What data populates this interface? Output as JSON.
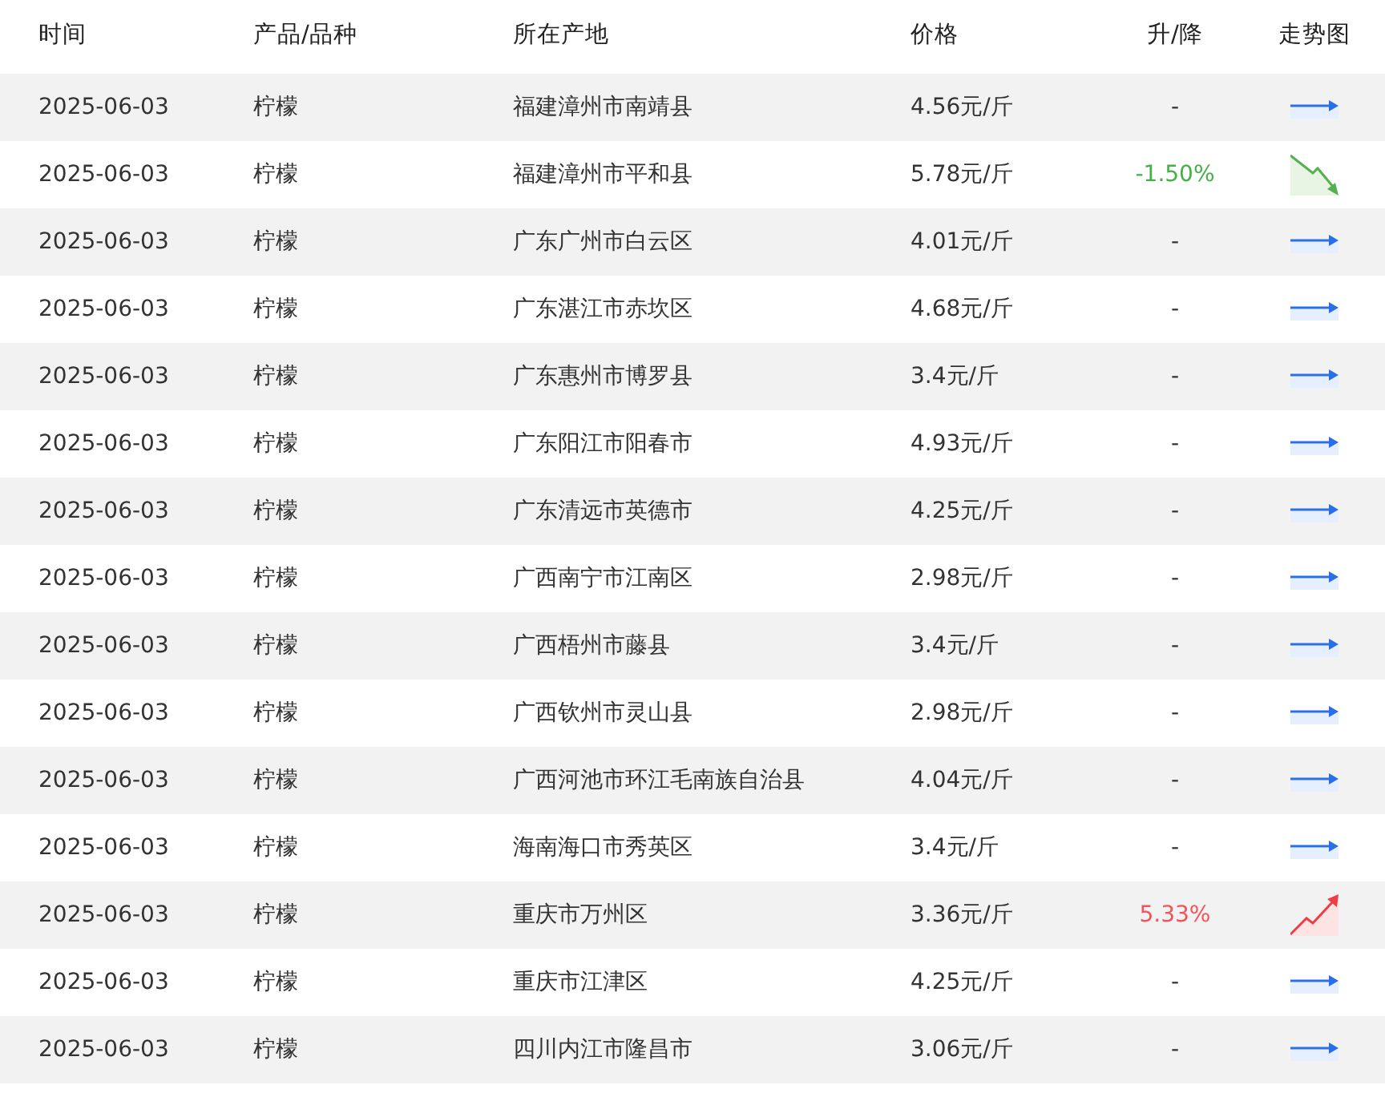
{
  "columns": [
    "时间",
    "产品/品种",
    "所在产地",
    "价格",
    "升/降",
    "走势图"
  ],
  "rows": [
    {
      "time": "2025-06-03",
      "product": "柠檬",
      "origin": "福建漳州市南靖县",
      "price": "4.56元/斤",
      "change": "-",
      "kind": "flat"
    },
    {
      "time": "2025-06-03",
      "product": "柠檬",
      "origin": "福建漳州市平和县",
      "price": "5.78元/斤",
      "change": "-1.50%",
      "kind": "down"
    },
    {
      "time": "2025-06-03",
      "product": "柠檬",
      "origin": "广东广州市白云区",
      "price": "4.01元/斤",
      "change": "-",
      "kind": "flat"
    },
    {
      "time": "2025-06-03",
      "product": "柠檬",
      "origin": "广东湛江市赤坎区",
      "price": "4.68元/斤",
      "change": "-",
      "kind": "flat"
    },
    {
      "time": "2025-06-03",
      "product": "柠檬",
      "origin": "广东惠州市博罗县",
      "price": "3.4元/斤",
      "change": "-",
      "kind": "flat"
    },
    {
      "time": "2025-06-03",
      "product": "柠檬",
      "origin": "广东阳江市阳春市",
      "price": "4.93元/斤",
      "change": "-",
      "kind": "flat"
    },
    {
      "time": "2025-06-03",
      "product": "柠檬",
      "origin": "广东清远市英德市",
      "price": "4.25元/斤",
      "change": "-",
      "kind": "flat"
    },
    {
      "time": "2025-06-03",
      "product": "柠檬",
      "origin": "广西南宁市江南区",
      "price": "2.98元/斤",
      "change": "-",
      "kind": "flat"
    },
    {
      "time": "2025-06-03",
      "product": "柠檬",
      "origin": "广西梧州市藤县",
      "price": "3.4元/斤",
      "change": "-",
      "kind": "flat"
    },
    {
      "time": "2025-06-03",
      "product": "柠檬",
      "origin": "广西钦州市灵山县",
      "price": "2.98元/斤",
      "change": "-",
      "kind": "flat"
    },
    {
      "time": "2025-06-03",
      "product": "柠檬",
      "origin": "广西河池市环江毛南族自治县",
      "price": "4.04元/斤",
      "change": "-",
      "kind": "flat"
    },
    {
      "time": "2025-06-03",
      "product": "柠檬",
      "origin": "海南海口市秀英区",
      "price": "3.4元/斤",
      "change": "-",
      "kind": "flat"
    },
    {
      "time": "2025-06-03",
      "product": "柠檬",
      "origin": "重庆市万州区",
      "price": "3.36元/斤",
      "change": "5.33%",
      "kind": "up"
    },
    {
      "time": "2025-06-03",
      "product": "柠檬",
      "origin": "重庆市江津区",
      "price": "4.25元/斤",
      "change": "-",
      "kind": "flat"
    },
    {
      "time": "2025-06-03",
      "product": "柠檬",
      "origin": "四川内江市隆昌市",
      "price": "3.06元/斤",
      "change": "-",
      "kind": "flat"
    }
  ]
}
